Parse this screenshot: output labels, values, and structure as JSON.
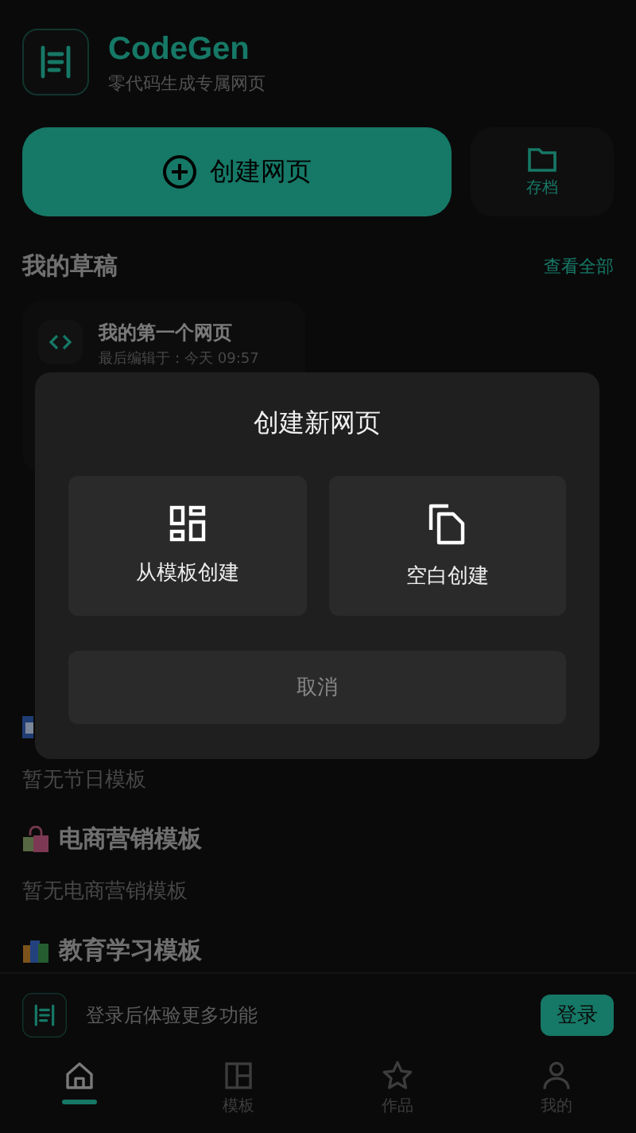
{
  "app": {
    "title": "CodeGen",
    "subtitle": "零代码生成专属网页"
  },
  "actions": {
    "create": "创建网页",
    "archive": "存档"
  },
  "drafts": {
    "title": "我的草稿",
    "view_all": "查看全部",
    "items": [
      {
        "name": "我的第一个网页",
        "edited": "最后编辑于：今天 09:57"
      }
    ]
  },
  "templates": [
    {
      "kind": "calendar",
      "empty": "暂无节日模板"
    },
    {
      "kind": "bag",
      "title": "电商营销模板",
      "empty": "暂无电商营销模板"
    },
    {
      "kind": "books",
      "title": "教育学习模板"
    }
  ],
  "dialog": {
    "title": "创建新网页",
    "options": [
      {
        "kind": "template",
        "label": "从模板创建"
      },
      {
        "kind": "blank",
        "label": "空白创建"
      }
    ],
    "cancel": "取消"
  },
  "login_bar": {
    "message": "登录后体验更多功能",
    "button": "登录"
  },
  "tabs": [
    {
      "kind": "home",
      "selected": true
    },
    {
      "kind": "templates",
      "label": "模板",
      "selected": false
    },
    {
      "kind": "works",
      "label": "作品",
      "selected": false
    },
    {
      "kind": "profile",
      "label": "我的",
      "selected": false
    }
  ]
}
